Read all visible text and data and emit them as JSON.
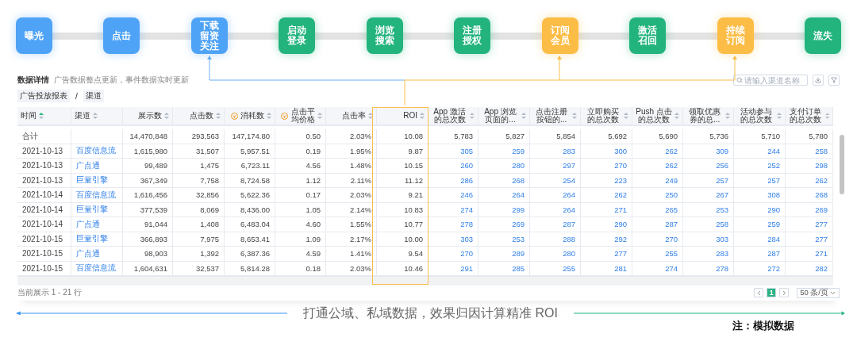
{
  "flow": [
    {
      "label": "曝光",
      "color": "#4fa3f6"
    },
    {
      "label": "点击",
      "color": "#4fa3f6"
    },
    {
      "label": "下载留资关注",
      "color": "#4fa3f6"
    },
    {
      "label": "启动登录",
      "color": "#23b47e"
    },
    {
      "label": "浏览搜索",
      "color": "#23b47e"
    },
    {
      "label": "注册授权",
      "color": "#23b47e"
    },
    {
      "label": "订阅会员",
      "color": "#fbbd46"
    },
    {
      "label": "激活召回",
      "color": "#23b47e"
    },
    {
      "label": "持续订阅",
      "color": "#fbbd46"
    },
    {
      "label": "流失",
      "color": "#23b47e"
    }
  ],
  "details": {
    "title": "数据详情",
    "subtitle": "广告数据整点更新，事件数据实时更新",
    "search": {
      "placeholder": "请输入渠道名称"
    }
  },
  "breadcrumb": [
    "广告投放报表",
    "/",
    "渠道"
  ],
  "table": {
    "columns": [
      {
        "label": "时间",
        "kind": "date",
        "sorted": true
      },
      {
        "label": "渠道",
        "kind": "channel",
        "sorted": false
      },
      {
        "label": "展示数",
        "kind": "number",
        "sorted": false
      },
      {
        "label": "点击数",
        "kind": "number",
        "sorted": false
      },
      {
        "label": "消耗数",
        "kind": "cost",
        "sorted": false
      },
      {
        "label": "点击平均价格",
        "kind": "cost",
        "sorted": false
      },
      {
        "label": "点击率",
        "kind": "number",
        "sorted": false
      },
      {
        "label": "ROI",
        "kind": "number",
        "sorted": false
      },
      {
        "label": "App 激活的总次数",
        "kind": "count",
        "sorted": false
      },
      {
        "label": "App 浏览页面的...",
        "kind": "count",
        "sorted": false
      },
      {
        "label": "点击注册按钮的...",
        "kind": "count",
        "sorted": false
      },
      {
        "label": "立即购买的总次数",
        "kind": "count",
        "sorted": false
      },
      {
        "label": "Push 点击的总次数",
        "kind": "count",
        "sorted": false
      },
      {
        "label": "领取优惠券的总...",
        "kind": "count",
        "sorted": false
      },
      {
        "label": "活动参与的总次数",
        "kind": "count",
        "sorted": false
      },
      {
        "label": "支付订单的总次数",
        "kind": "count",
        "sorted": false
      }
    ],
    "rows": [
      {
        "kind": "total",
        "date": "合计",
        "values": [
          "14,470,848",
          "293,563",
          "147,174.80",
          "0.50",
          "2.03%",
          "10.08",
          "5,783",
          "5,827",
          "5,854",
          "5,692",
          "5,690",
          "5,736",
          "5,710",
          "5,780"
        ]
      },
      {
        "kind": "data",
        "date": "2021-10-13",
        "channel": "百度信息流",
        "values": [
          "1,615,980",
          "31,507",
          "5,957.51",
          "0.19",
          "1.95%",
          "9.87",
          "305",
          "259",
          "283",
          "300",
          "262",
          "309",
          "244",
          "258"
        ]
      },
      {
        "kind": "data",
        "date": "2021-10-13",
        "channel": "广点通",
        "values": [
          "99,489",
          "1,475",
          "6,723.11",
          "4.56",
          "1.48%",
          "10.15",
          "260",
          "280",
          "297",
          "270",
          "262",
          "256",
          "252",
          "298"
        ]
      },
      {
        "kind": "data",
        "date": "2021-10-13",
        "channel": "巨量引擎",
        "values": [
          "367,349",
          "7,758",
          "8,724.58",
          "1.12",
          "2.11%",
          "11.12",
          "286",
          "268",
          "254",
          "223",
          "249",
          "257",
          "257",
          "262"
        ]
      },
      {
        "kind": "data",
        "date": "2021-10-14",
        "channel": "百度信息流",
        "values": [
          "1,616,456",
          "32,856",
          "5,622.36",
          "0.17",
          "2.03%",
          "9.21",
          "246",
          "264",
          "264",
          "262",
          "250",
          "267",
          "308",
          "268"
        ]
      },
      {
        "kind": "data",
        "date": "2021-10-14",
        "channel": "巨量引擎",
        "values": [
          "377,539",
          "8,069",
          "8,436.00",
          "1.05",
          "2.14%",
          "10.83",
          "274",
          "299",
          "264",
          "271",
          "265",
          "253",
          "290",
          "269"
        ]
      },
      {
        "kind": "data",
        "date": "2021-10-14",
        "channel": "广点通",
        "values": [
          "91,044",
          "1,408",
          "6,483.04",
          "4.60",
          "1.55%",
          "10.77",
          "278",
          "269",
          "287",
          "290",
          "287",
          "258",
          "259",
          "277"
        ]
      },
      {
        "kind": "data",
        "date": "2021-10-15",
        "channel": "巨量引擎",
        "values": [
          "366,893",
          "7,975",
          "8,653.41",
          "1.09",
          "2.17%",
          "10.00",
          "303",
          "253",
          "288",
          "292",
          "270",
          "303",
          "284",
          "277"
        ]
      },
      {
        "kind": "data",
        "date": "2021-10-15",
        "channel": "广点通",
        "values": [
          "98,903",
          "1,392",
          "6,387.36",
          "4.59",
          "1.41%",
          "9.54",
          "270",
          "289",
          "280",
          "277",
          "255",
          "283",
          "287",
          "271"
        ]
      },
      {
        "kind": "data",
        "date": "2021-10-15",
        "channel": "百度信息流",
        "values": [
          "1,604,631",
          "32,537",
          "5,814.28",
          "0.18",
          "2.03%",
          "10.46",
          "291",
          "285",
          "255",
          "281",
          "274",
          "278",
          "272",
          "282"
        ]
      }
    ]
  },
  "footer": {
    "summary": "当前展示 1 - 21 行",
    "pages": [
      {
        "label": "1",
        "selected": true
      }
    ],
    "page_size": "50 条/页"
  },
  "caption": "打通公域、私域数据，效果归因计算精准 ROI",
  "note": "注：模拟数据"
}
